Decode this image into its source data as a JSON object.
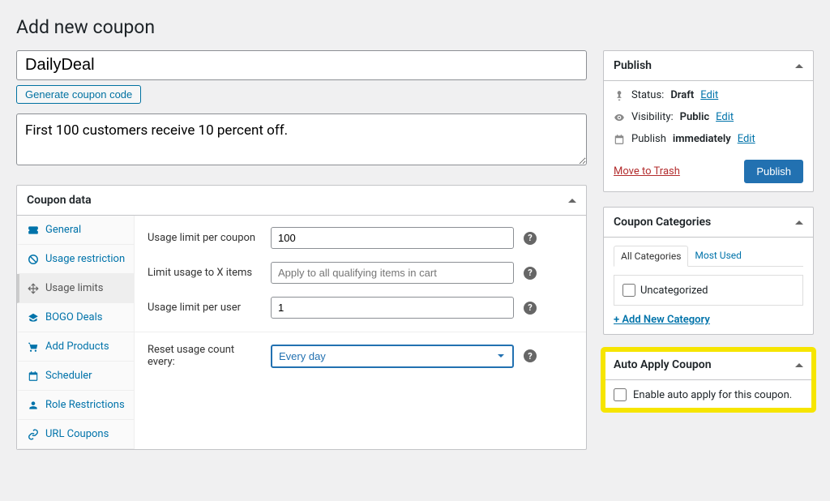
{
  "page_title": "Add new coupon",
  "coupon": {
    "code": "DailyDeal",
    "description": "First 100 customers receive 10 percent off."
  },
  "buttons": {
    "generate_code": "Generate coupon code",
    "publish": "Publish",
    "move_trash": "Move to Trash"
  },
  "coupon_data": {
    "header": "Coupon data",
    "tabs": {
      "general": "General",
      "usage_restriction": "Usage restriction",
      "usage_limits": "Usage limits",
      "bogo": "BOGO Deals",
      "add_products": "Add Products",
      "scheduler": "Scheduler",
      "role": "Role Restrictions",
      "url_coupons": "URL Coupons"
    },
    "fields": {
      "usage_limit_coupon": {
        "label": "Usage limit per coupon",
        "value": "100"
      },
      "limit_x_items": {
        "label": "Limit usage to X items",
        "placeholder": "Apply to all qualifying items in cart"
      },
      "usage_limit_user": {
        "label": "Usage limit per user",
        "value": "1"
      },
      "reset_count": {
        "label": "Reset usage count every:",
        "value": "Every day"
      }
    }
  },
  "publish": {
    "header": "Publish",
    "status_label": "Status:",
    "status_value": "Draft",
    "visibility_label": "Visibility:",
    "visibility_value": "Public",
    "publish_label": "Publish",
    "publish_value": "immediately",
    "edit": "Edit"
  },
  "categories": {
    "header": "Coupon Categories",
    "tab_all": "All Categories",
    "tab_most": "Most Used",
    "uncategorized": "Uncategorized",
    "add_new": "+ Add New Category"
  },
  "auto_apply": {
    "header": "Auto Apply Coupon",
    "label": "Enable auto apply for this coupon."
  }
}
